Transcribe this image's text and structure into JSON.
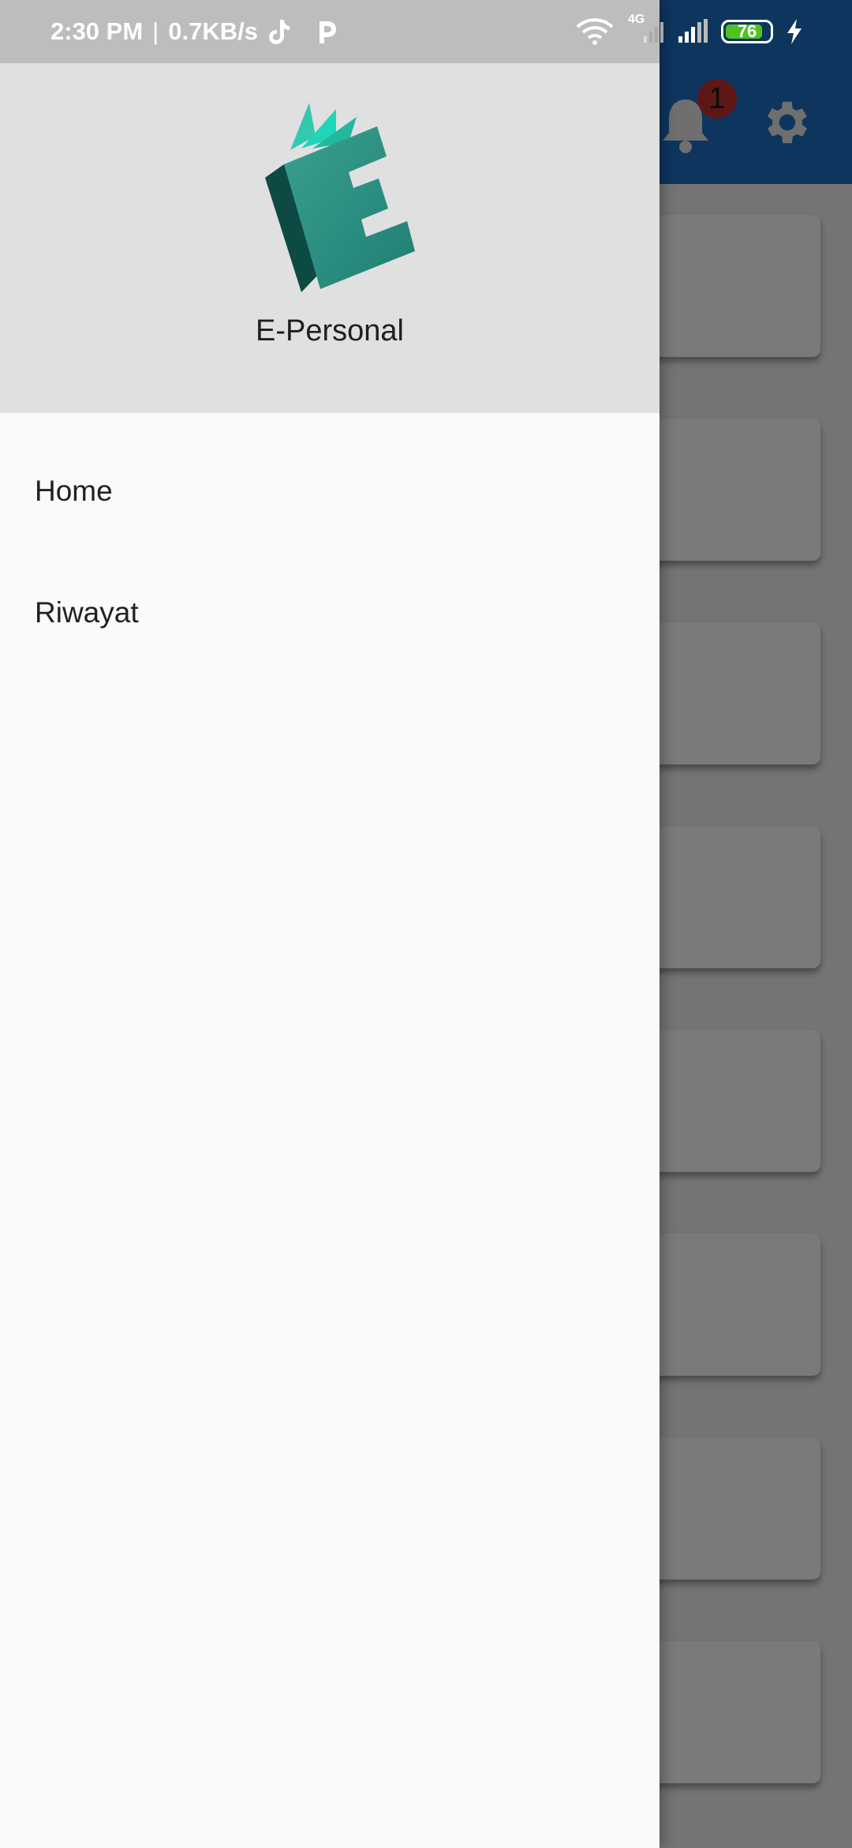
{
  "status_bar": {
    "time": "2:30 PM",
    "separator": "|",
    "speed": "0.7KB/s",
    "network_type": "4G",
    "battery_level": "76",
    "icons": [
      "tiktok-icon",
      "p-app-icon",
      "wifi-icon",
      "signal-4g-icon",
      "signal-icon",
      "battery-icon",
      "charging-bolt-icon"
    ]
  },
  "background_app": {
    "notification_badge": "1",
    "appbar_color": "#1e6fc4",
    "card_count": 8
  },
  "drawer": {
    "app_name": "E-Personal",
    "logo_icon": "book-e-logo",
    "menu": [
      {
        "label": "Home"
      },
      {
        "label": "Riwayat"
      }
    ]
  },
  "colors": {
    "header_bg": "#e0e0e0",
    "drawer_bg": "#fafafa",
    "logo_teal": "#2a8f80",
    "logo_dark": "#0d4a44",
    "battery_green": "#4fc41f"
  }
}
